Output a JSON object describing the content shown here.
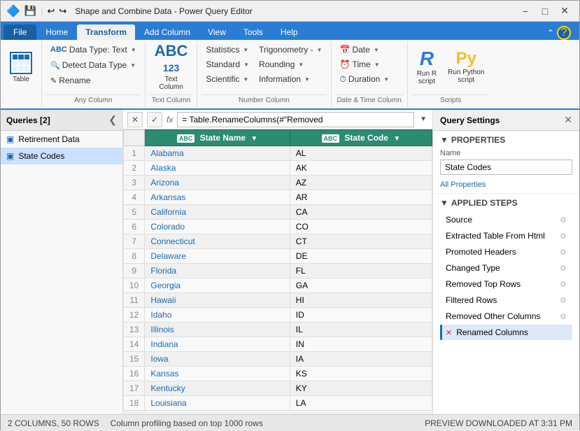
{
  "titlebar": {
    "title": "Shape and Combine Data - Power Query Editor",
    "save_icon": "💾",
    "undo_icon": "↩",
    "redo_icon": "↪"
  },
  "ribbon_tabs": [
    {
      "label": "File",
      "active": false,
      "is_file": true
    },
    {
      "label": "Home",
      "active": false
    },
    {
      "label": "Transform",
      "active": true
    },
    {
      "label": "Add Column",
      "active": false
    },
    {
      "label": "View",
      "active": false
    },
    {
      "label": "Tools",
      "active": false
    },
    {
      "label": "Help",
      "active": false
    }
  ],
  "ribbon": {
    "groups": [
      {
        "label": "Any Column",
        "items": [
          {
            "type": "btn_sm",
            "label": "Data Type: Text",
            "icon": "ABC",
            "has_dropdown": true
          },
          {
            "type": "btn_sm",
            "label": "Detect Data Type",
            "icon": "🔍",
            "has_dropdown": true
          },
          {
            "type": "btn_sm",
            "label": "Rename",
            "icon": "✎",
            "has_dropdown": false
          }
        ]
      },
      {
        "label": "Text Column",
        "items": [
          {
            "label": "Text Column",
            "icon": "ABC\n123"
          }
        ]
      },
      {
        "label": "Number Column",
        "items": [
          {
            "type": "dropdown",
            "label": "Statistics",
            "has_dropdown": true
          },
          {
            "type": "dropdown",
            "label": "Standard",
            "has_dropdown": true
          },
          {
            "type": "dropdown",
            "label": "Scientific",
            "has_dropdown": true
          },
          {
            "type": "dropdown",
            "label": "Trigonometry -",
            "has_dropdown": true
          },
          {
            "type": "dropdown",
            "label": "Rounding",
            "has_dropdown": true
          },
          {
            "type": "dropdown",
            "label": "Information",
            "has_dropdown": true
          }
        ]
      },
      {
        "label": "Date & Time Column",
        "items": [
          {
            "type": "dropdown",
            "label": "Date",
            "has_dropdown": true,
            "icon": "📅"
          },
          {
            "type": "dropdown",
            "label": "Time",
            "has_dropdown": true,
            "icon": "⏰"
          },
          {
            "type": "dropdown",
            "label": "Duration",
            "has_dropdown": true,
            "icon": "⏱"
          }
        ]
      },
      {
        "label": "Scripts",
        "items": [
          {
            "label": "Run R\nscript",
            "icon": "R"
          },
          {
            "label": "Run Python\nscript",
            "icon": "Py"
          }
        ]
      }
    ]
  },
  "queries_panel": {
    "title": "Queries [2]",
    "items": [
      {
        "label": "Retirement Data",
        "icon": "📋",
        "active": false
      },
      {
        "label": "State Codes",
        "icon": "📋",
        "active": true
      }
    ]
  },
  "formula_bar": {
    "cancel_icon": "✕",
    "confirm_icon": "✓",
    "formula": "= Table.RenameColumns(#\"Removed"
  },
  "table": {
    "columns": [
      {
        "label": "State Name",
        "type": "ABC"
      },
      {
        "label": "State Code",
        "type": "ABC"
      }
    ],
    "rows": [
      {
        "num": 1,
        "state": "Alabama",
        "code": "AL"
      },
      {
        "num": 2,
        "state": "Alaska",
        "code": "AK"
      },
      {
        "num": 3,
        "state": "Arizona",
        "code": "AZ"
      },
      {
        "num": 4,
        "state": "Arkansas",
        "code": "AR"
      },
      {
        "num": 5,
        "state": "California",
        "code": "CA"
      },
      {
        "num": 6,
        "state": "Colorado",
        "code": "CO"
      },
      {
        "num": 7,
        "state": "Connecticut",
        "code": "CT"
      },
      {
        "num": 8,
        "state": "Delaware",
        "code": "DE"
      },
      {
        "num": 9,
        "state": "Florida",
        "code": "FL"
      },
      {
        "num": 10,
        "state": "Georgia",
        "code": "GA"
      },
      {
        "num": 11,
        "state": "Hawaii",
        "code": "HI"
      },
      {
        "num": 12,
        "state": "Idaho",
        "code": "ID"
      },
      {
        "num": 13,
        "state": "Illinois",
        "code": "IL"
      },
      {
        "num": 14,
        "state": "Indiana",
        "code": "IN"
      },
      {
        "num": 15,
        "state": "Iowa",
        "code": "IA"
      },
      {
        "num": 16,
        "state": "Kansas",
        "code": "KS"
      },
      {
        "num": 17,
        "state": "Kentucky",
        "code": "KY"
      },
      {
        "num": 18,
        "state": "Louisiana",
        "code": "LA"
      }
    ]
  },
  "query_settings": {
    "title": "Query Settings",
    "properties_label": "PROPERTIES",
    "name_label": "Name",
    "query_name": "State Codes",
    "all_properties_link": "All Properties",
    "applied_steps_label": "APPLIED STEPS",
    "steps": [
      {
        "label": "Source",
        "has_gear": true,
        "active": false,
        "has_error": false
      },
      {
        "label": "Extracted Table From Html",
        "has_gear": true,
        "active": false,
        "has_error": false
      },
      {
        "label": "Promoted Headers",
        "has_gear": true,
        "active": false,
        "has_error": false
      },
      {
        "label": "Changed Type",
        "has_gear": true,
        "active": false,
        "has_error": false
      },
      {
        "label": "Removed Top Rows",
        "has_gear": true,
        "active": false,
        "has_error": false
      },
      {
        "label": "Filtered Rows",
        "has_gear": true,
        "active": false,
        "has_error": false
      },
      {
        "label": "Removed Other Columns",
        "has_gear": true,
        "active": false,
        "has_error": false
      },
      {
        "label": "Renamed Columns",
        "has_gear": false,
        "active": true,
        "has_error": true
      }
    ]
  },
  "status_bar": {
    "columns": "2 COLUMNS, 50 ROWS",
    "profiling": "Column profiling based on top 1000 rows",
    "preview": "PREVIEW DOWNLOADED AT 3:31 PM"
  }
}
